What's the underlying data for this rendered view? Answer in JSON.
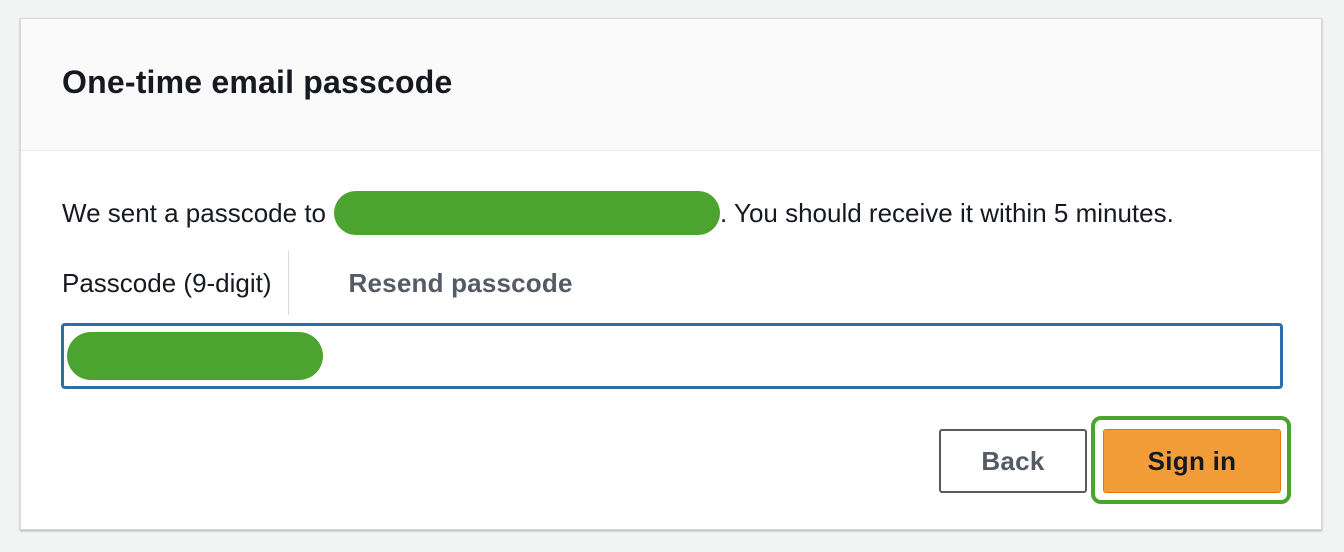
{
  "header": {
    "title": "One-time email passcode"
  },
  "message": {
    "prefix": "We sent a passcode to",
    "suffix": ". You should receive it within 5 minutes."
  },
  "passcode": {
    "label": "Passcode (9-digit)",
    "resend_label": "Resend passcode",
    "value": ""
  },
  "actions": {
    "back_label": "Back",
    "sign_in_label": "Sign in"
  },
  "colors": {
    "accent": "#f29d38",
    "focus_border": "#2e6ea8",
    "highlight": "#4aa42f"
  }
}
